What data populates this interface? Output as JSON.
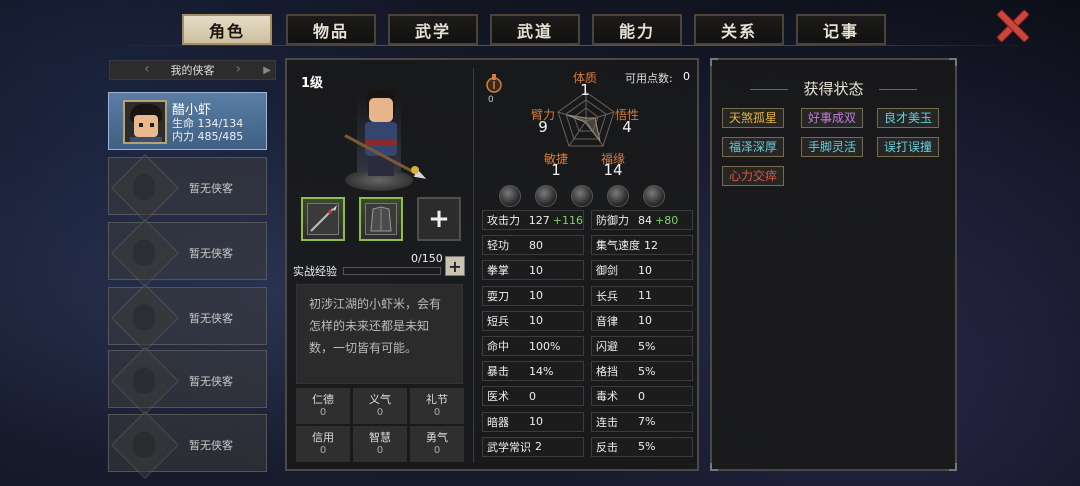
{
  "tabs": [
    "角色",
    "物品",
    "武学",
    "武道",
    "能力",
    "关系",
    "记事"
  ],
  "active_tab": 0,
  "roster": {
    "header": "我的侠客",
    "hero": {
      "name": "醋小虾",
      "hp": "生命 134/134",
      "mp": "内力 485/485"
    },
    "empty_label": "暂无侠客",
    "empty_count": 5
  },
  "character": {
    "level": "1级",
    "xp_label": "实战经验",
    "xp_value": "0/150",
    "xp_progress": 0,
    "description": "初涉江湖的小虾米，会有怎样的未来还都是未知数，一切皆有可能。",
    "virtues": [
      {
        "name": "仁德",
        "value": "0"
      },
      {
        "name": "义气",
        "value": "0"
      },
      {
        "name": "礼节",
        "value": "0"
      },
      {
        "name": "信用",
        "value": "0"
      },
      {
        "name": "智慧",
        "value": "0"
      },
      {
        "name": "勇气",
        "value": "0"
      }
    ]
  },
  "attributes": {
    "points_label": "可用点数:",
    "points_value": "0",
    "potion_value": "0",
    "list": [
      {
        "name": "体质",
        "value": "1"
      },
      {
        "name": "悟性",
        "value": "4"
      },
      {
        "name": "福缘",
        "value": "14"
      },
      {
        "name": "敏捷",
        "value": "1"
      },
      {
        "name": "臂力",
        "value": "9"
      }
    ]
  },
  "stats": [
    {
      "name": "攻击力",
      "value": "127",
      "bonus": "+116"
    },
    {
      "name": "防御力",
      "value": "84",
      "bonus": "+80"
    },
    {
      "name": "轻功",
      "value": "80",
      "bonus": ""
    },
    {
      "name": "集气速度",
      "value": "12",
      "bonus": ""
    },
    {
      "name": "拳掌",
      "value": "10",
      "bonus": ""
    },
    {
      "name": "御剑",
      "value": "10",
      "bonus": ""
    },
    {
      "name": "耍刀",
      "value": "10",
      "bonus": ""
    },
    {
      "name": "长兵",
      "value": "11",
      "bonus": ""
    },
    {
      "name": "短兵",
      "value": "10",
      "bonus": ""
    },
    {
      "name": "音律",
      "value": "10",
      "bonus": ""
    },
    {
      "name": "命中",
      "value": "100%",
      "bonus": ""
    },
    {
      "name": "闪避",
      "value": "5%",
      "bonus": ""
    },
    {
      "name": "暴击",
      "value": "14%",
      "bonus": ""
    },
    {
      "name": "格挡",
      "value": "5%",
      "bonus": ""
    },
    {
      "name": "医术",
      "value": "0",
      "bonus": ""
    },
    {
      "name": "毒术",
      "value": "0",
      "bonus": ""
    },
    {
      "name": "暗器",
      "value": "10",
      "bonus": ""
    },
    {
      "name": "连击",
      "value": "7%",
      "bonus": ""
    },
    {
      "name": "武学常识",
      "value": "2",
      "bonus": ""
    },
    {
      "name": "反击",
      "value": "5%",
      "bonus": ""
    }
  ],
  "status": {
    "title": "获得状态",
    "tags": [
      {
        "label": "天煞孤星",
        "color": "#e6b43e"
      },
      {
        "label": "好事成双",
        "color": "#c27ad8"
      },
      {
        "label": "良才美玉",
        "color": "#66cfd9"
      },
      {
        "label": "福泽深厚",
        "color": "#66cfd9"
      },
      {
        "label": "手脚灵活",
        "color": "#66cfd9"
      },
      {
        "label": "误打误撞",
        "color": "#66cfd9"
      },
      {
        "label": "心力交瘁",
        "color": "#e0553f"
      }
    ]
  }
}
